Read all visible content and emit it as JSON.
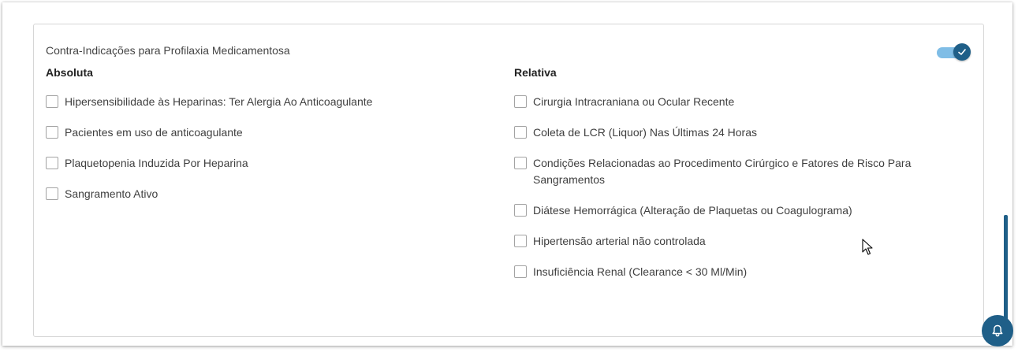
{
  "section": {
    "title": "Contra-Indicações para Profilaxia Medicamentosa",
    "toggle_on": true
  },
  "absoluta": {
    "heading": "Absoluta",
    "items": [
      {
        "label": "Hipersensibilidade às Heparinas: Ter Alergia Ao Anticoagulante",
        "checked": false
      },
      {
        "label": "Pacientes em uso de anticoagulante",
        "checked": false
      },
      {
        "label": "Plaquetopenia Induzida Por Heparina",
        "checked": false
      },
      {
        "label": "Sangramento Ativo",
        "checked": false
      }
    ]
  },
  "relativa": {
    "heading": "Relativa",
    "items": [
      {
        "label": "Cirurgia Intracraniana ou Ocular Recente",
        "checked": false
      },
      {
        "label": "Coleta de LCR (Liquor) Nas Últimas 24 Horas",
        "checked": false
      },
      {
        "label": "Condições Relacionadas ao Procedimento Cirúrgico e Fatores de Risco Para Sangramentos",
        "checked": false
      },
      {
        "label": "Diátese Hemorrágica (Alteração de Plaquetas ou Coagulograma)",
        "checked": false
      },
      {
        "label": "Hipertensão arterial não controlada",
        "checked": false
      },
      {
        "label": "Insuficiência Renal (Clearance < 30 Ml/Min)",
        "checked": false
      }
    ]
  },
  "icons": {
    "toggle_check": "check-icon",
    "notification": "bell-icon",
    "pointer": "mouse-cursor-icon"
  },
  "colors": {
    "accent": "#1f5f88",
    "toggle_track": "#7fbde6"
  }
}
